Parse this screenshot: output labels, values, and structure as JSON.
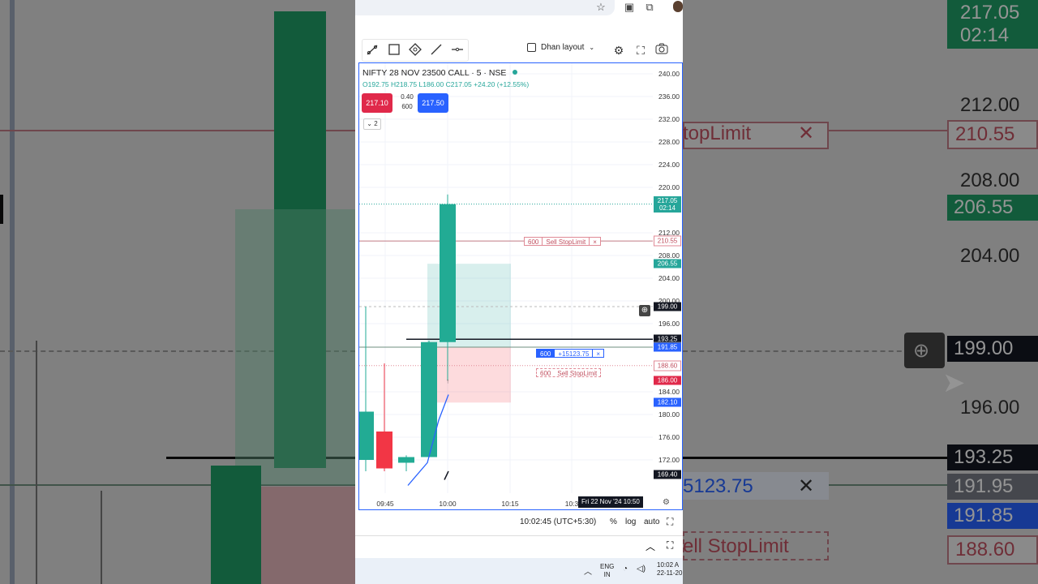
{
  "browser": {
    "icons": [
      "star-icon",
      "extension-icon",
      "puzzle-icon",
      "profile-avatar"
    ]
  },
  "toolbar": {
    "tools": [
      "trend-line-icon",
      "rectangle-icon",
      "path-icon",
      "ray-icon",
      "horizontal-line-icon"
    ],
    "layout_label": "Dhan layout"
  },
  "chart": {
    "symbol": "NIFTY 28 NOV 23500 CALL · 5 · NSE",
    "ohlc": {
      "o": "O192.75",
      "h": "H218.75",
      "l": "L186.00",
      "c": "C217.05",
      "chg": "+24.20 (+12.55%)"
    },
    "sell_price": "217.10",
    "spread": "0.40",
    "qty": "600",
    "buy_price": "217.50",
    "collapse_count": "2",
    "orders": [
      {
        "qty": "600",
        "label": "Sell StopLimit",
        "close": "×"
      },
      {
        "qty": "600",
        "label": "+15123.75",
        "close": "×"
      },
      {
        "qty": "600",
        "label": "Sell StopLimit",
        "close": "×"
      }
    ],
    "x_labels": [
      "09:45",
      "10:00",
      "10:15",
      "10:3"
    ],
    "crosshair_date": "Fri 22 Nov '24   10:50"
  },
  "chart_data": {
    "type": "candlestick",
    "ylim": [
      167,
      241
    ],
    "y_ticks": [
      "240.00",
      "236.00",
      "232.00",
      "228.00",
      "224.00",
      "220.00",
      "212.00",
      "208.00",
      "204.00",
      "200.00",
      "196.00",
      "184.00",
      "180.00",
      "176.00",
      "172.00"
    ],
    "price_tags": [
      {
        "label": "217.05",
        "sub": "02:14",
        "value": 217.05,
        "color": "#26a69a"
      },
      {
        "label": "210.55",
        "value": 210.55,
        "color": "outline-red"
      },
      {
        "label": "206.55",
        "value": 206.55,
        "color": "#26a69a"
      },
      {
        "label": "199.00",
        "value": 199.0,
        "color": "#131722"
      },
      {
        "label": "193.25",
        "value": 193.25,
        "color": "#131722"
      },
      {
        "label": "191.95",
        "value": 191.95,
        "color": "#787b86"
      },
      {
        "label": "191.85",
        "value": 191.85,
        "color": "#2962ff"
      },
      {
        "label": "188.60",
        "value": 188.6,
        "color": "outline-red"
      },
      {
        "label": "186.00",
        "value": 186.0,
        "color": "#e0294a"
      },
      {
        "label": "182.10",
        "value": 182.1,
        "color": "#2962ff"
      },
      {
        "label": "169.40",
        "value": 169.4,
        "color": "#131722"
      }
    ],
    "candles": [
      {
        "t": "09:35",
        "o": 172.0,
        "h": 199.0,
        "l": 170.0,
        "c": 180.5
      },
      {
        "t": "09:40",
        "o": 177.0,
        "h": 189.0,
        "l": 170.0,
        "c": 170.5
      },
      {
        "t": "09:45",
        "o": 171.5,
        "h": 172.8,
        "l": 170.0,
        "c": 172.5
      },
      {
        "t": "09:50",
        "o": 172.5,
        "h": 193.0,
        "l": 172.5,
        "c": 192.75
      },
      {
        "t": "09:55",
        "o": 192.75,
        "h": 218.75,
        "l": 186.0,
        "c": 217.05
      }
    ]
  }
}
